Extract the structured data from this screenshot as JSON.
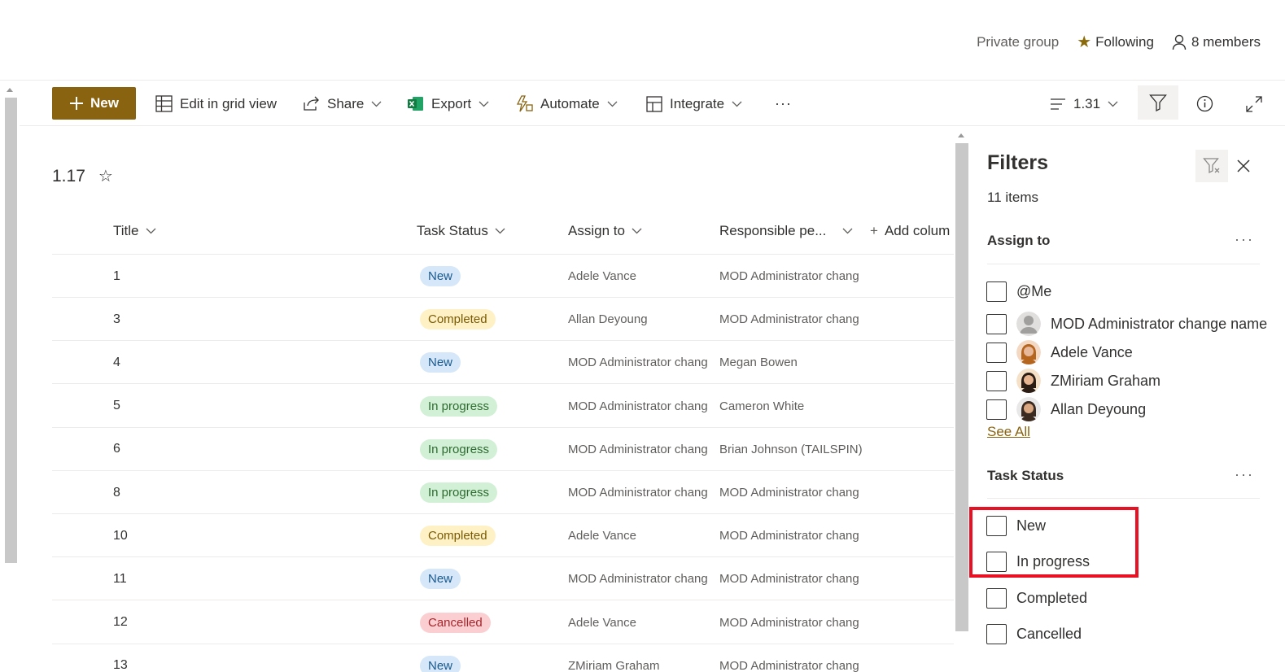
{
  "header": {
    "privacy": "Private group",
    "following_label": "Following",
    "members_label": "8 members"
  },
  "commandbar": {
    "new_label": "New",
    "edit_grid_label": "Edit in grid view",
    "share_label": "Share",
    "export_label": "Export",
    "automate_label": "Automate",
    "integrate_label": "Integrate",
    "more_label": "···",
    "view_name": "1.31"
  },
  "list": {
    "view_title": "1.17",
    "columns": {
      "title": "Title",
      "task_status": "Task Status",
      "assign_to": "Assign to",
      "responsible": "Responsible pe...",
      "add_column": "Add colum"
    },
    "rows": [
      {
        "title": "1",
        "status": "New",
        "status_key": "new",
        "assign": "Adele Vance",
        "responsible": "MOD Administrator chang"
      },
      {
        "title": "3",
        "status": "Completed",
        "status_key": "completed",
        "assign": "Allan Deyoung",
        "responsible": "MOD Administrator chang"
      },
      {
        "title": "4",
        "status": "New",
        "status_key": "new",
        "assign": "MOD Administrator chang",
        "responsible": "Megan Bowen"
      },
      {
        "title": "5",
        "status": "In progress",
        "status_key": "inprogress",
        "assign": "MOD Administrator chang",
        "responsible": "Cameron White"
      },
      {
        "title": "6",
        "status": "In progress",
        "status_key": "inprogress",
        "assign": "MOD Administrator chang",
        "responsible": "Brian Johnson (TAILSPIN)"
      },
      {
        "title": "8",
        "status": "In progress",
        "status_key": "inprogress",
        "assign": "MOD Administrator chang",
        "responsible": "MOD Administrator chang"
      },
      {
        "title": "10",
        "status": "Completed",
        "status_key": "completed",
        "assign": "Adele Vance",
        "responsible": "MOD Administrator chang"
      },
      {
        "title": "11",
        "status": "New",
        "status_key": "new",
        "assign": "MOD Administrator chang",
        "responsible": "MOD Administrator chang"
      },
      {
        "title": "12",
        "status": "Cancelled",
        "status_key": "cancelled",
        "assign": "Adele Vance",
        "responsible": "MOD Administrator chang"
      },
      {
        "title": "13",
        "status": "New",
        "status_key": "new",
        "assign": "ZMiriam Graham",
        "responsible": "MOD Administrator chang"
      }
    ]
  },
  "filters": {
    "title": "Filters",
    "count": "11 items",
    "assign_section": {
      "label": "Assign to",
      "more": "···",
      "options": [
        "@Me",
        "MOD Administrator change name",
        "Adele Vance",
        "ZMiriam Graham",
        "Allan Deyoung"
      ],
      "see_all": "See All"
    },
    "status_section": {
      "label": "Task Status",
      "more": "···",
      "options": [
        "New",
        "In progress",
        "Completed",
        "Cancelled"
      ]
    }
  },
  "colors": {
    "brand": "#8a6310",
    "highlight": "#e81123"
  }
}
